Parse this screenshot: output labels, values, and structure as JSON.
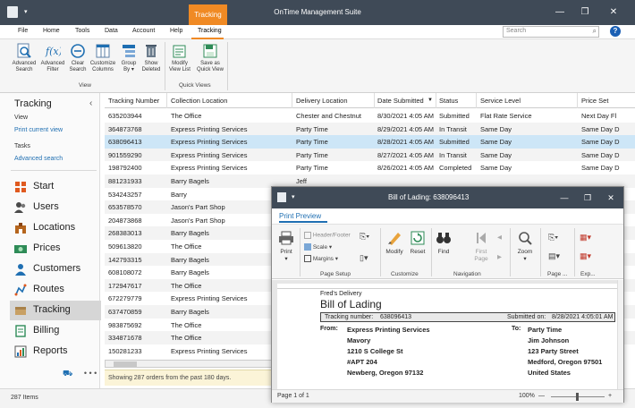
{
  "app": {
    "title": "OnTime Management Suite",
    "context_tab": "Tracking",
    "qa_arrow": "▾",
    "window_controls": [
      "—",
      "❐",
      "✕"
    ]
  },
  "menu": {
    "items": [
      "File",
      "Home",
      "Tools",
      "Data",
      "Account",
      "Help",
      "Tracking"
    ],
    "search_placeholder": "Search",
    "help": "?"
  },
  "ribbon": {
    "buttons": [
      {
        "label": "Advanced\nSearch",
        "icon": "advanced-search-icon"
      },
      {
        "label": "Advanced\nFilter",
        "icon": "advanced-filter-icon"
      },
      {
        "label": "Clear\nSearch",
        "icon": "clear-search-icon"
      },
      {
        "label": "Customize\nColumns",
        "icon": "customize-columns-icon"
      },
      {
        "label": "Group\nBy ▾",
        "icon": "group-by-icon"
      },
      {
        "label": "Show\nDeleted",
        "icon": "show-deleted-icon"
      },
      {
        "label": "Modify\nView List",
        "icon": "modify-view-icon"
      },
      {
        "label": "Save as\nQuick View",
        "icon": "save-quick-view-icon"
      }
    ],
    "groups": [
      "View",
      "Quick Views"
    ]
  },
  "sidebar": {
    "title": "Tracking",
    "collapse": "‹",
    "view_label": "View",
    "view_link": "Print current view",
    "tasks_label": "Tasks",
    "tasks_link": "Advanced search",
    "nav": [
      "Start",
      "Users",
      "Locations",
      "Prices",
      "Customers",
      "Routes",
      "Tracking",
      "Billing",
      "Reports"
    ],
    "selected": "Tracking",
    "more": "• • •"
  },
  "grid": {
    "columns": [
      "Tracking Number",
      "Collection Location",
      "Delivery Location",
      "Date Submitted",
      "Status",
      "Service Level",
      "Price Set"
    ],
    "sort_indicator": "▼",
    "rows": [
      [
        "635203944",
        "The Office",
        "Chester and Chestnut",
        "8/30/2021 4:05 AM",
        "Submitted",
        "Flat Rate Service",
        "Next Day Fl"
      ],
      [
        "364873768",
        "Express Printing Services",
        "Party Time",
        "8/29/2021 4:05 AM",
        "In Transit",
        "Same Day",
        "Same Day D"
      ],
      [
        "638096413",
        "Express Printing Services",
        "Party Time",
        "8/28/2021 4:05 AM",
        "Submitted",
        "Same Day",
        "Same Day D"
      ],
      [
        "901559290",
        "Express Printing Services",
        "Party Time",
        "8/27/2021 4:05 AM",
        "In Transit",
        "Same Day",
        "Same Day D"
      ],
      [
        "198792400",
        "Express Printing Services",
        "Party Time",
        "8/26/2021 4:05 AM",
        "Completed",
        "Same Day",
        "Same Day D"
      ],
      [
        "881231933",
        "Barry Bagels",
        "Jeff",
        "",
        "",
        "",
        ""
      ],
      [
        "534243257",
        "Barry",
        "",
        "",
        "",
        "",
        ""
      ],
      [
        "653578570",
        "Jason's Part Shop",
        "",
        "",
        "",
        "",
        ""
      ],
      [
        "204873868",
        "Jason's Part Shop",
        "",
        "",
        "",
        "",
        ""
      ],
      [
        "268383013",
        "Barry Bagels",
        "",
        "",
        "",
        "",
        ""
      ],
      [
        "509613820",
        "The Office",
        "",
        "",
        "",
        "",
        ""
      ],
      [
        "142793315",
        "Barry Bagels",
        "",
        "",
        "",
        "",
        ""
      ],
      [
        "608108072",
        "Barry Bagels",
        "",
        "",
        "",
        "",
        ""
      ],
      [
        "172947617",
        "The Office",
        "",
        "",
        "",
        "",
        ""
      ],
      [
        "672279779",
        "Express Printing Services",
        "",
        "",
        "",
        "",
        ""
      ],
      [
        "637470859",
        "Barry Bagels",
        "",
        "",
        "",
        "",
        ""
      ],
      [
        "983875692",
        "The Office",
        "",
        "",
        "",
        "",
        ""
      ],
      [
        "334871678",
        "The Office",
        "",
        "",
        "",
        "",
        ""
      ],
      [
        "150281233",
        "Express Printing Services",
        "",
        "",
        "",
        "",
        ""
      ]
    ],
    "selected_row": 2,
    "footer": "Showing 287 orders from the past 180 days."
  },
  "status": {
    "items": "287 Items"
  },
  "print_preview": {
    "title": "Bill of Lading: 638096413",
    "tab": "Print Preview",
    "buttons": {
      "print": "Print\n▾",
      "header_footer": "Header/Footer",
      "scale": "Scale ▾",
      "margins": "Margins ▾",
      "modify": "Modify",
      "reset": "Reset",
      "find": "Find",
      "first_page": "First\nPage",
      "zoom": "Zoom\n▾"
    },
    "groups": [
      "Page Setup",
      "Customize",
      "Navigation",
      "Page ...",
      "Exp..."
    ],
    "doc": {
      "company": "Fred's Delivery",
      "heading": "Bill of Lading",
      "tracking_label": "Tracking number:",
      "tracking_value": "638096413",
      "submitted_label": "Submitted on:",
      "submitted_value": "8/28/2021 4:05:01 AM",
      "from_label": "From:",
      "from_lines": [
        "Express Printing Services",
        "Mavory",
        "1210 S College St",
        "#APT 204",
        "Newberg, Oregon  97132"
      ],
      "to_label": "To:",
      "to_lines": [
        "Party Time",
        "Jim Johnson",
        "123 Party Street",
        "Medford, Oregon  97501",
        "United States"
      ]
    },
    "page_status": "Page 1 of 1",
    "zoom": "100%",
    "zoom_minus": "—",
    "zoom_plus": "+"
  },
  "colors": {
    "accent": "#f08a24",
    "titlebar": "#3f4a57",
    "selection": "#cde6f7",
    "link": "#1f6fb2"
  }
}
